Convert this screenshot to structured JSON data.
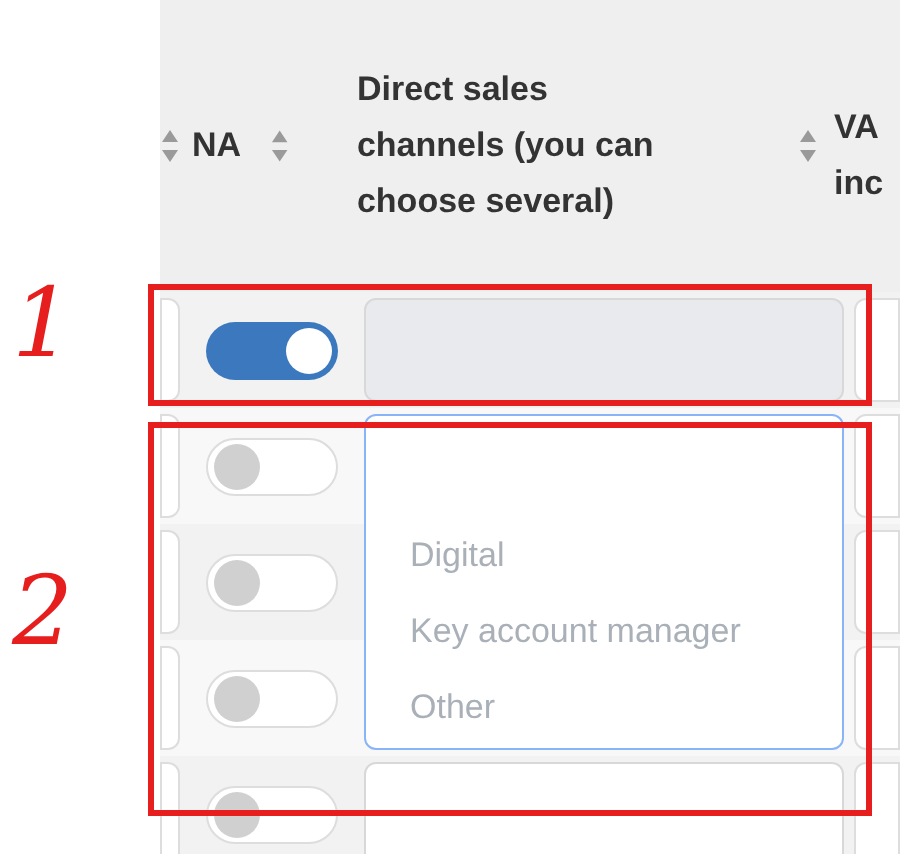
{
  "table": {
    "columns": [
      {
        "label": "NA"
      },
      {
        "label": "Direct sales channels (you can choose several)"
      },
      {
        "label": "VA inc"
      }
    ],
    "rows": [
      {
        "na_on": true,
        "kind": "select"
      },
      {
        "na_on": false,
        "kind": "open_select"
      },
      {
        "na_on": false,
        "kind": "covered"
      },
      {
        "na_on": false,
        "kind": "covered"
      },
      {
        "na_on": false,
        "kind": "select"
      }
    ]
  },
  "dropdown": {
    "options": [
      {
        "label": "Digital"
      },
      {
        "label": "Key account manager"
      },
      {
        "label": "Other"
      }
    ]
  },
  "annotations": [
    {
      "label": "1"
    },
    {
      "label": "2"
    }
  ]
}
